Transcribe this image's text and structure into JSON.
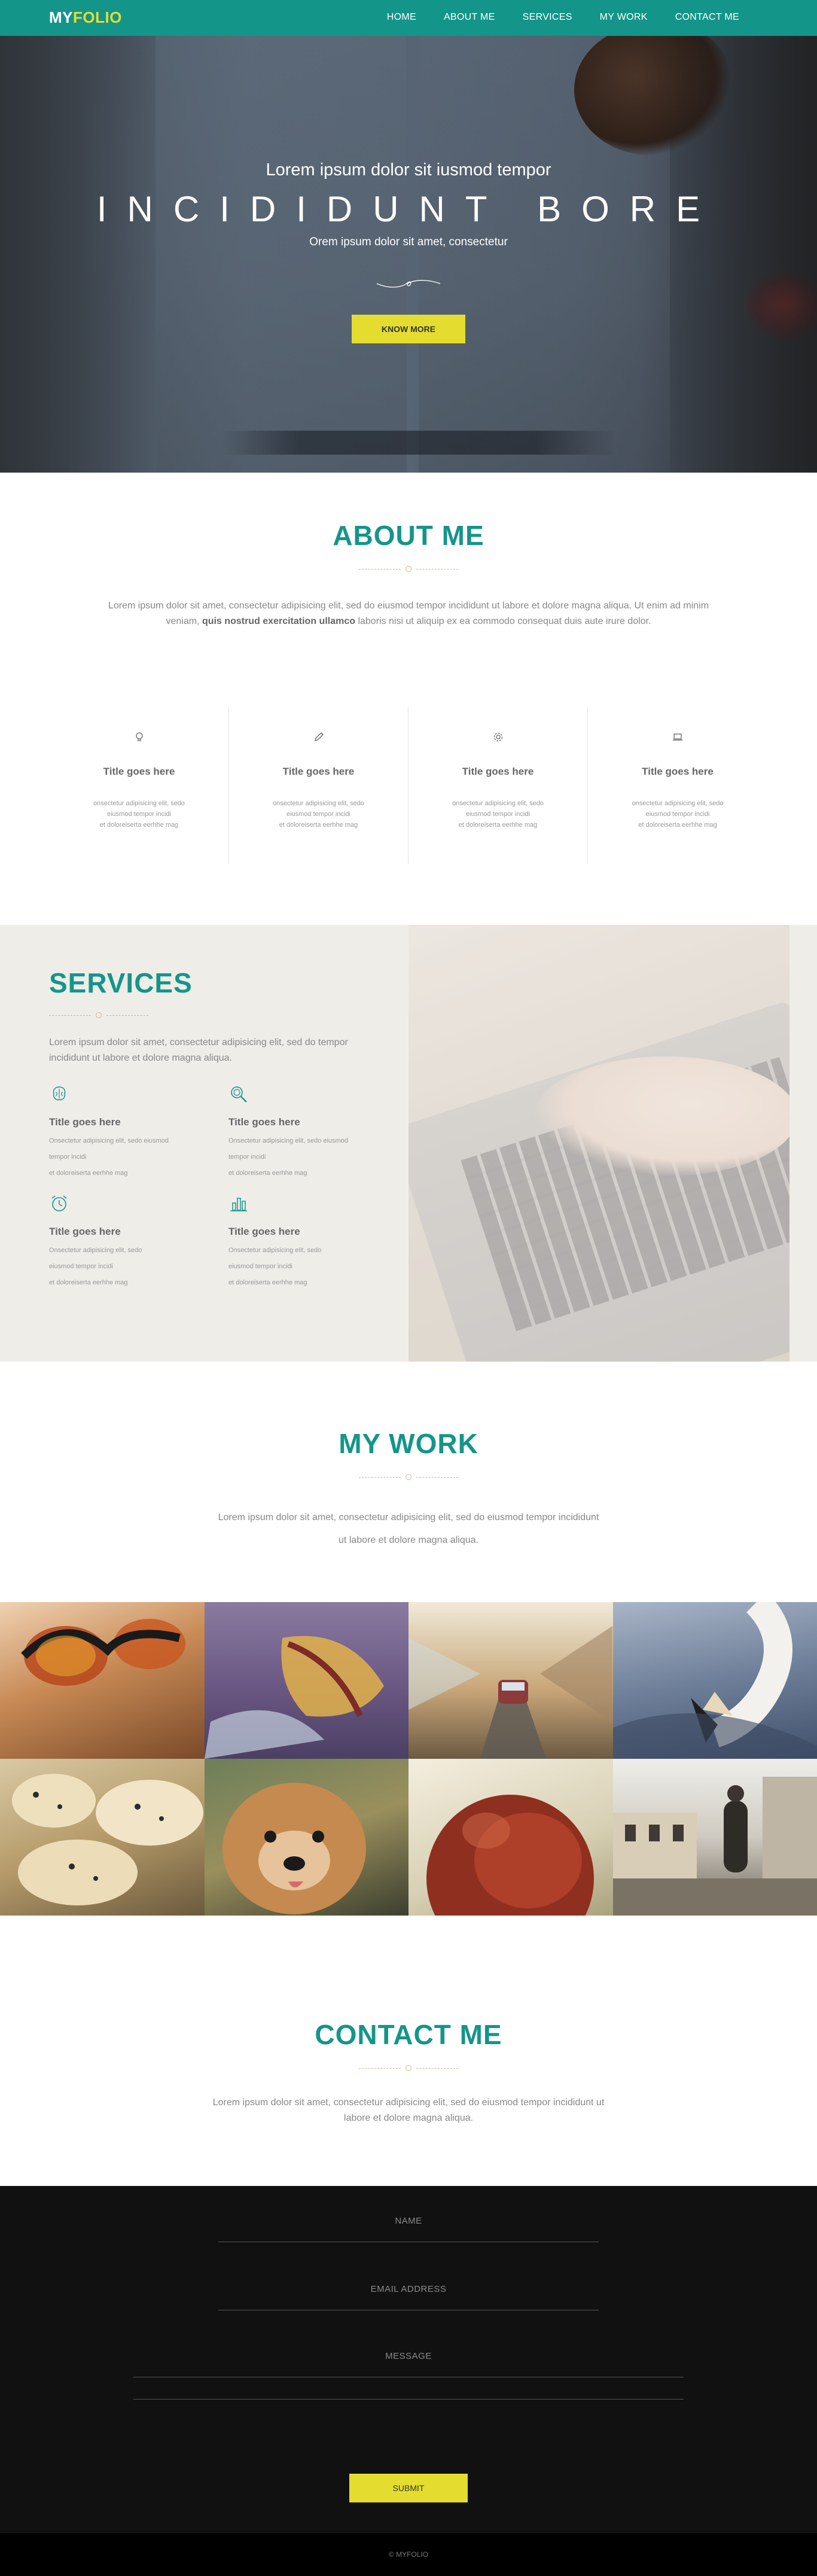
{
  "nav": {
    "logo_part1": "MY",
    "logo_part2": "FOLIO",
    "links": [
      "HOME",
      "ABOUT ME",
      "SERVICES",
      "MY WORK",
      "CONTACT ME"
    ]
  },
  "hero": {
    "subtitle": "Lorem ipsum dolor sit iusmod tempor",
    "title": "INCIDIDUNT BORE",
    "tagline": "Orem ipsum dolor sit amet, consectetur",
    "button": "KNOW MORE"
  },
  "about": {
    "title": "ABOUT ME",
    "text_before": "Lorem ipsum dolor sit amet, consectetur adipisicing elit, sed do eiusmod tempor incididunt ut labore et dolore magna aliqua. Ut enim ad minim veniam,",
    "text_bold": "quis nostrud exercitation ullamco",
    "text_after": "laboris nisi ut aliquip ex ea commodo consequat duis aute irure dolor.",
    "features": [
      {
        "icon": "lightbulb-icon",
        "title": "Title goes here",
        "line1": "onsectetur adipisicing elit, sedo",
        "line2": "eiusmod tempor incidi",
        "line3": "et doloreiserta eerhhe mag"
      },
      {
        "icon": "pencil-icon",
        "title": "Title goes here",
        "line1": "onsectetur adipisicing elit, sedo",
        "line2": "eiusmod tempor incidi",
        "line3": "et doloreiserta eerhhe mag"
      },
      {
        "icon": "gear-icon",
        "title": "Title goes here",
        "line1": "onsectetur adipisicing elit, sedo",
        "line2": "eiusmod tempor incidi",
        "line3": "et doloreiserta eerhhe mag"
      },
      {
        "icon": "laptop-icon",
        "title": "Title goes here",
        "line1": "onsectetur adipisicing elit, sedo",
        "line2": "eiusmod tempor incidi",
        "line3": "et doloreiserta eerhhe mag"
      }
    ]
  },
  "services": {
    "title": "SERVICES",
    "lead": "Lorem ipsum dolor sit amet, consectetur adipisicing elit, sed do tempor incididunt ut labore et dolore magna aliqua.",
    "items": [
      {
        "icon": "brain-icon",
        "title": "Title goes here",
        "line1": "Onsectetur adipisicing elit, sedo eiusmod",
        "line2": "tempor incidi",
        "line3": "et doloreiserta eerhhe mag"
      },
      {
        "icon": "magnifier-icon",
        "title": "Title goes here",
        "line1": "Onsectetur adipisicing elit, sedo eiusmod",
        "line2": "tempor incidi",
        "line3": "et doloreiserta eerhhe mag"
      },
      {
        "icon": "alarm-clock-icon",
        "title": "Title goes here",
        "line1": "Onsectetur adipisicing elit, sedo",
        "line2": "eiusmod tempor incidi",
        "line3": "et doloreiserta eerhhe mag"
      },
      {
        "icon": "bar-chart-icon",
        "title": "Title goes here",
        "line1": "Onsectetur adipisicing elit, sedo",
        "line2": "eiusmod tempor incidi",
        "line3": "et doloreiserta eerhhe mag"
      }
    ]
  },
  "work": {
    "title": "MY WORK",
    "lead": "Lorem ipsum dolor sit amet, consectetur adipisicing elit, sed do eiusmod tempor incididunt ut labore et dolore magna aliqua.",
    "tiles": [
      "sunglasses",
      "feather",
      "car-on-road",
      "swan",
      "cookies",
      "dog",
      "red-hair",
      "woman-walking-street"
    ]
  },
  "contact": {
    "title": "CONTACT ME",
    "lead": "Lorem ipsum dolor sit amet, consectetur adipisicing elit, sed do eiusmod tempor incididunt ut labore et dolore magna aliqua.",
    "name_placeholder": "NAME",
    "email_placeholder": "EMAIL ADDRESS",
    "message_placeholder": "MESSAGE",
    "submit": "SUBMIT"
  },
  "footer": {
    "text": "© MYFOLIO"
  },
  "colors": {
    "brand": "#14958a",
    "accent": "#e4dd2f",
    "dark": "#111111"
  }
}
